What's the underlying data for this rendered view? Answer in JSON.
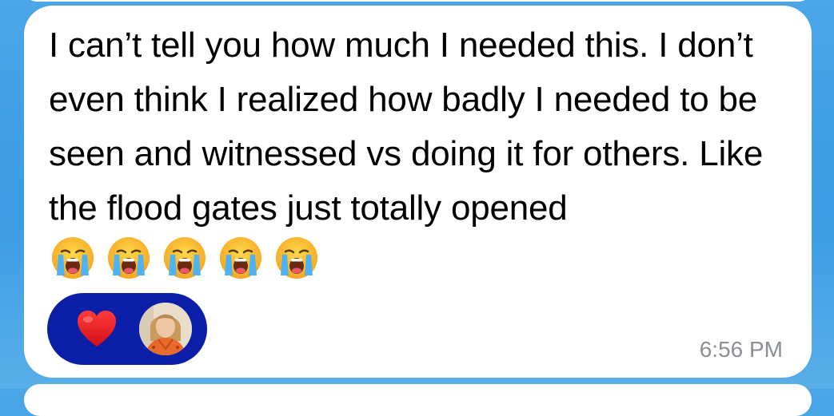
{
  "message": {
    "text": "I can’t tell you how much I needed this. I don’t even think I realized how badly I needed to be seen and witnessed vs doing it for others. Like the flood gates just totally opened",
    "emojis": [
      "loudly-crying-face",
      "loudly-crying-face",
      "loudly-crying-face",
      "loudly-crying-face",
      "loudly-crying-face"
    ],
    "timestamp": "6:56 PM"
  },
  "reaction": {
    "emoji": "red-heart",
    "count_avatars": 1
  },
  "colors": {
    "background": "#3b9ce2",
    "bubble": "#ffffff",
    "reaction_pill": "#0a1ea8",
    "timestamp": "#8b8f93",
    "heart": "#e8141c"
  }
}
